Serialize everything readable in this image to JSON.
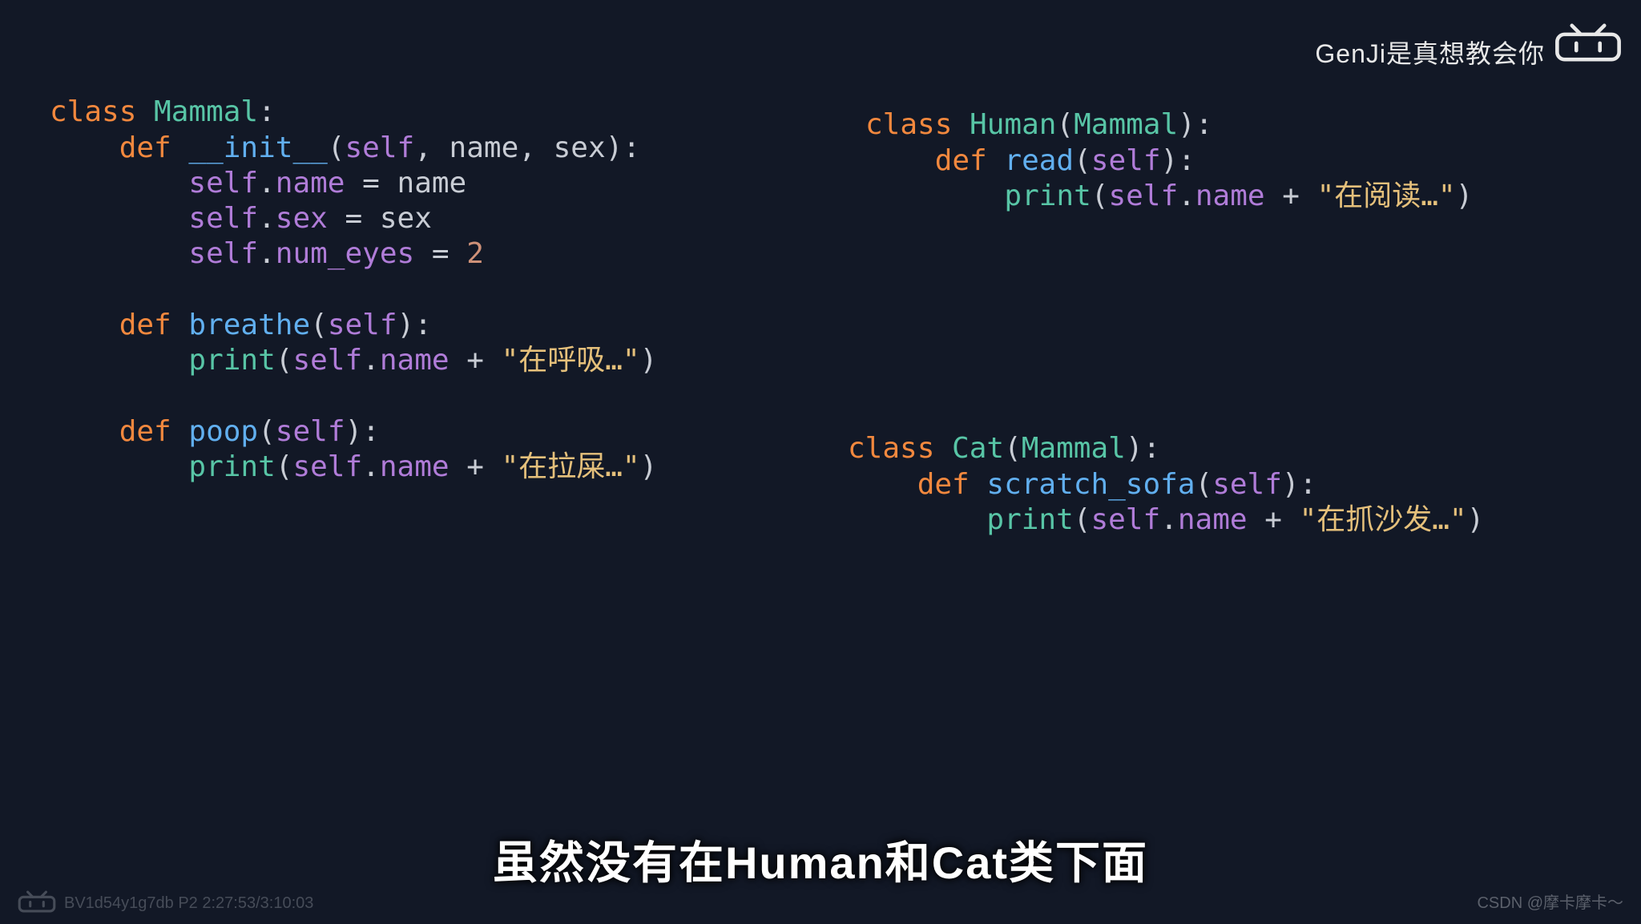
{
  "credit_top": "GenJi是真想教会你",
  "subtitle": "虽然没有在Human和Cat类下面",
  "video_meta": "BV1d54y1g7db P2 2:27:53/3:10:03",
  "csdn_credit": "CSDN @摩卡摩卡～",
  "code_left": {
    "l1": {
      "kw": "class ",
      "cls": "Mammal",
      "colon": ":"
    },
    "l2": {
      "pad": "    ",
      "kw": "def ",
      "fn": "__init__",
      "op1": "(",
      "self": "self",
      "c1": ", ",
      "p1": "name",
      "c2": ", ",
      "p2": "sex",
      "op2": "):"
    },
    "l3": {
      "pad": "        ",
      "self": "self",
      "dot": ".",
      "attr": "name",
      "eq": " = ",
      "val": "name"
    },
    "l4": {
      "pad": "        ",
      "self": "self",
      "dot": ".",
      "attr": "sex",
      "eq": " = ",
      "val": "sex"
    },
    "l5": {
      "pad": "        ",
      "self": "self",
      "dot": ".",
      "attr": "num_eyes",
      "eq": " = ",
      "val": "2"
    },
    "l7": {
      "pad": "    ",
      "kw": "def ",
      "fn": "breathe",
      "op1": "(",
      "self": "self",
      "op2": "):"
    },
    "l8": {
      "pad": "        ",
      "call": "print",
      "op1": "(",
      "self": "self",
      "dot": ".",
      "attr": "name",
      "plus": " + ",
      "str": "\"在呼吸…\"",
      "op2": ")"
    },
    "l10": {
      "pad": "    ",
      "kw": "def ",
      "fn": "poop",
      "op1": "(",
      "self": "self",
      "op2": "):"
    },
    "l11": {
      "pad": "        ",
      "call": "print",
      "op1": "(",
      "self": "self",
      "dot": ".",
      "attr": "name",
      "plus": " + ",
      "str": "\"在拉屎…\"",
      "op2": ")"
    }
  },
  "code_r1": {
    "l1": {
      "kw": "class ",
      "cls": "Human",
      "op1": "(",
      "base": "Mammal",
      "op2": "):"
    },
    "l2": {
      "pad": "    ",
      "kw": "def ",
      "fn": "read",
      "op1": "(",
      "self": "self",
      "op2": "):"
    },
    "l3": {
      "pad": "        ",
      "call": "print",
      "op1": "(",
      "self": "self",
      "dot": ".",
      "attr": "name",
      "plus": " + ",
      "str": "\"在阅读…\"",
      "op2": ")"
    }
  },
  "code_r2": {
    "l1": {
      "kw": "class ",
      "cls": "Cat",
      "op1": "(",
      "base": "Mammal",
      "op2": "):"
    },
    "l2": {
      "pad": "    ",
      "kw": "def ",
      "fn": "scratch_sofa",
      "op1": "(",
      "self": "self",
      "op2": "):"
    },
    "l3": {
      "pad": "        ",
      "call": "print",
      "op1": "(",
      "self": "self",
      "dot": ".",
      "attr": "name",
      "plus": " + ",
      "str": "\"在抓沙发…\"",
      "op2": ")"
    }
  }
}
